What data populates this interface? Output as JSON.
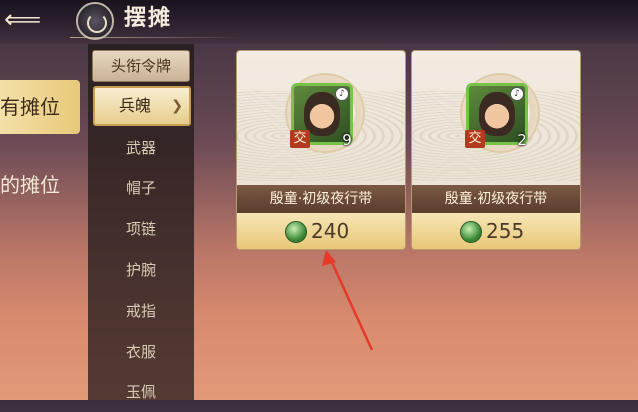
{
  "header": {
    "back_icon": "back-arrow-icon",
    "title": "摆摊"
  },
  "left_tabs": [
    {
      "label": "所有摊位",
      "visible": "有摊位",
      "active": true
    },
    {
      "label": "我的摊位",
      "visible": "的摊位",
      "active": false
    }
  ],
  "categories": {
    "header": "头衔令牌",
    "selected": "兵魄",
    "items": [
      "武器",
      "帽子",
      "项链",
      "护腕",
      "戒指",
      "衣服",
      "玉佩"
    ]
  },
  "listings": [
    {
      "name": "殷童·初级夜行带",
      "badge": "交",
      "count": "9",
      "price": "240"
    },
    {
      "name": "殷童·初级夜行带",
      "badge": "交",
      "count": "2",
      "price": "255"
    }
  ],
  "colors": {
    "accent_gold": "#e8c878",
    "annotation_arrow": "#e53a2a"
  }
}
